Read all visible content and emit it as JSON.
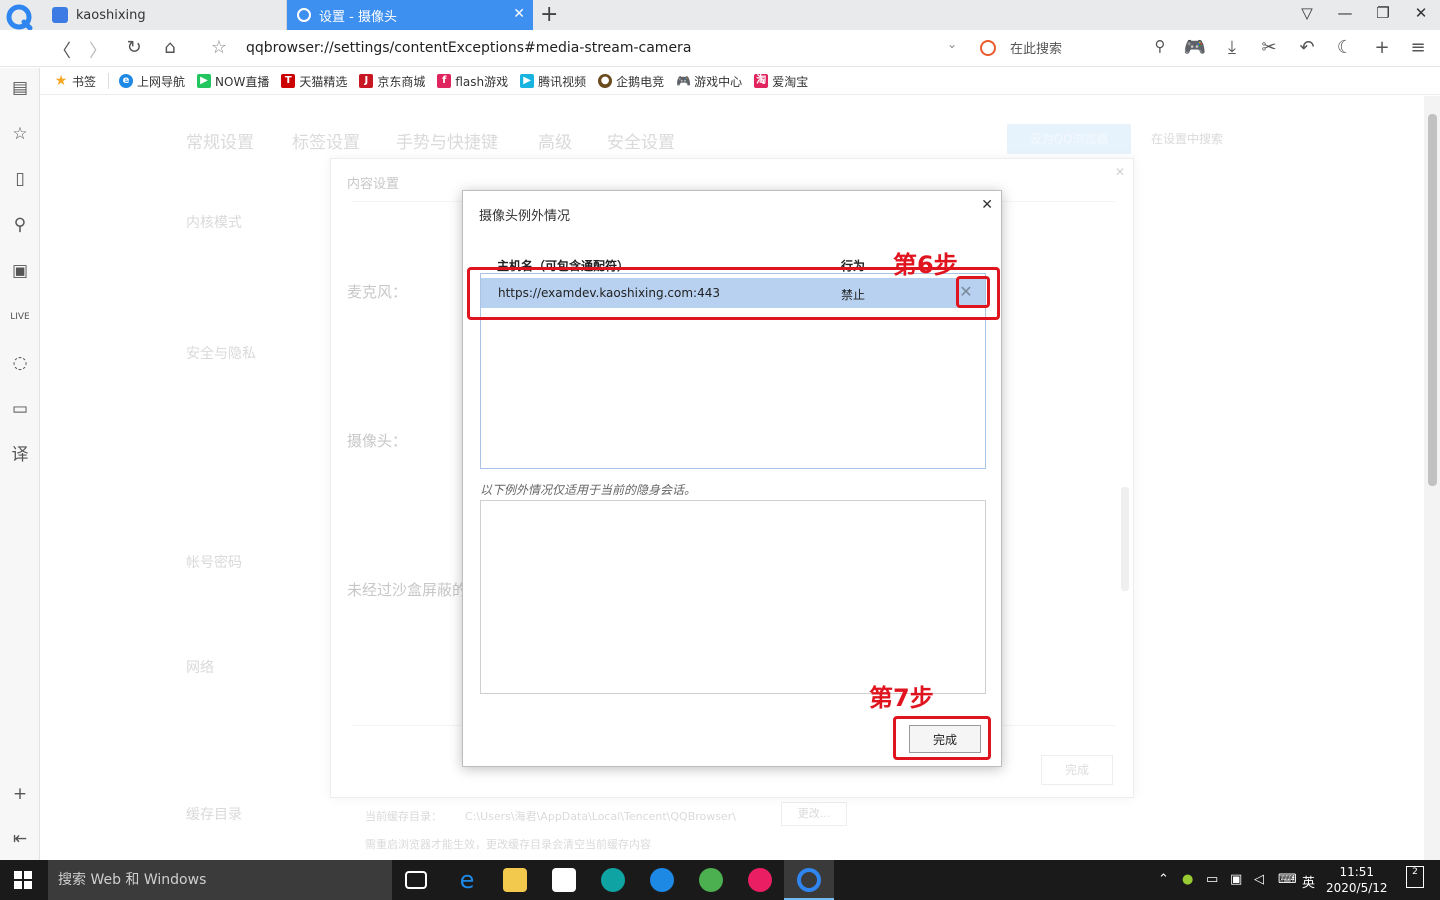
{
  "tabs": [
    {
      "title": "kaoshixing"
    },
    {
      "title": "设置 - 摄像头"
    }
  ],
  "address_bar": {
    "url": "qqbrowser://settings/contentExceptions#media-stream-camera",
    "search_placeholder": "在此搜索"
  },
  "bookmarks": [
    "书签",
    "上网导航",
    "NOW直播",
    "天猫精选",
    "京东商城",
    "flash游戏",
    "腾讯视频",
    "企鹅电竞",
    "游戏中心",
    "爱淘宝"
  ],
  "settings_bg": {
    "nav": [
      "常规设置",
      "标签设置",
      "手势与快捷键",
      "高级",
      "安全设置"
    ],
    "default_browser_btn": "设为QQ浏览器",
    "search_placeholder": "在设置中搜索",
    "left_items": [
      "内核模式",
      "安全与隐私",
      "帐号密码",
      "网络",
      "缓存目录"
    ],
    "content_dialog_title": "内容设置",
    "rows": [
      "麦克风：",
      "摄像头：",
      "未经过沙盒屏蔽的"
    ],
    "done_label": "完成",
    "cache_path_label": "当前缓存目录：",
    "cache_path": "C:\\Users\\海君\\AppData\\Local\\Tencent\\QQBrowser\\",
    "change_btn": "更改...",
    "cache_note": "需重启浏览器才能生效，更改缓存目录会清空当前缓存内容"
  },
  "camera_dialog": {
    "title": "摄像头例外情况",
    "col_host": "主机名（可包含通配符）",
    "col_action": "行为",
    "rows": [
      {
        "host": "https://examdev.kaoshixing.com:443",
        "action": "禁止"
      }
    ],
    "incognito_note": "以下例外情况仅适用于当前的隐身会话。",
    "done_label": "完成"
  },
  "annotations": {
    "step6": "第6步",
    "step7": "第7步"
  },
  "taskbar": {
    "search": "搜索 Web 和 Windows",
    "ime": "英",
    "time": "11:51",
    "date": "2020/5/12",
    "notifications": "2"
  },
  "colors": {
    "accent": "#3d8ff0",
    "annotation": "#e0141e",
    "selected_row": "#b8d1f1"
  }
}
